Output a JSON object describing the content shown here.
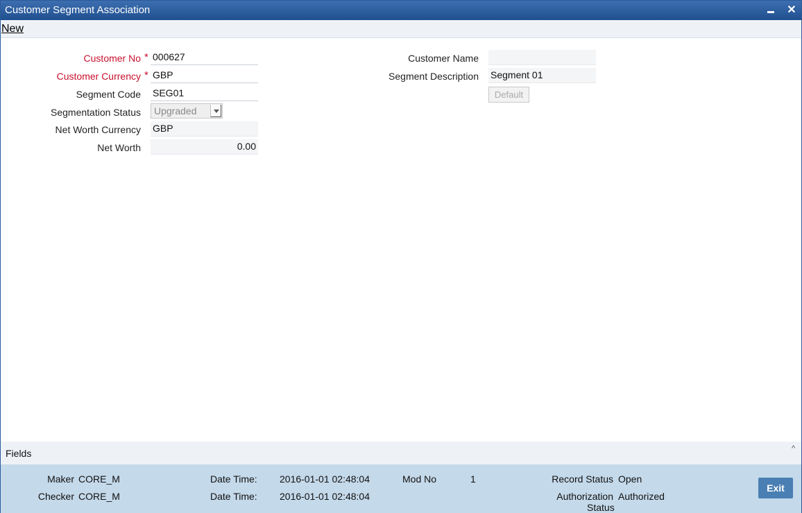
{
  "window": {
    "title": "Customer Segment Association"
  },
  "toolbar": {
    "new_label": "New"
  },
  "form": {
    "customer_no": {
      "label": "Customer No",
      "value": "000627",
      "required": "*"
    },
    "customer_currency": {
      "label": "Customer Currency",
      "value": "GBP",
      "required": "*"
    },
    "segment_code": {
      "label": "Segment Code",
      "value": "SEG01"
    },
    "segmentation_status": {
      "label": "Segmentation Status",
      "value": "Upgraded"
    },
    "net_worth_currency": {
      "label": "Net Worth Currency",
      "value": "GBP"
    },
    "net_worth": {
      "label": "Net Worth",
      "value": "0.00"
    },
    "customer_name": {
      "label": "Customer Name",
      "value": ""
    },
    "segment_description": {
      "label": "Segment Description",
      "value": "Segment 01"
    },
    "default_button": "Default"
  },
  "fields_bar": {
    "label": "Fields"
  },
  "footer": {
    "maker_label": "Maker",
    "maker_value": "CORE_M",
    "checker_label": "Checker",
    "checker_value": "CORE_M",
    "maker_datetime_label": "Date Time:",
    "maker_datetime_value": "2016-01-01 02:48:04",
    "checker_datetime_label": "Date Time:",
    "checker_datetime_value": "2016-01-01 02:48:04",
    "mod_no_label": "Mod No",
    "mod_no_value": "1",
    "record_status_label": "Record Status",
    "record_status_value": "Open",
    "auth_status_label_line1": "Authorization",
    "auth_status_label_line2": "Status",
    "auth_status_value": "Authorized",
    "exit_label": "Exit"
  },
  "colors": {
    "titlebar": "#2a5c9c",
    "required": "#c8102e",
    "footer_bg": "#c4d9ea",
    "exit_button": "#4a7fb3"
  }
}
